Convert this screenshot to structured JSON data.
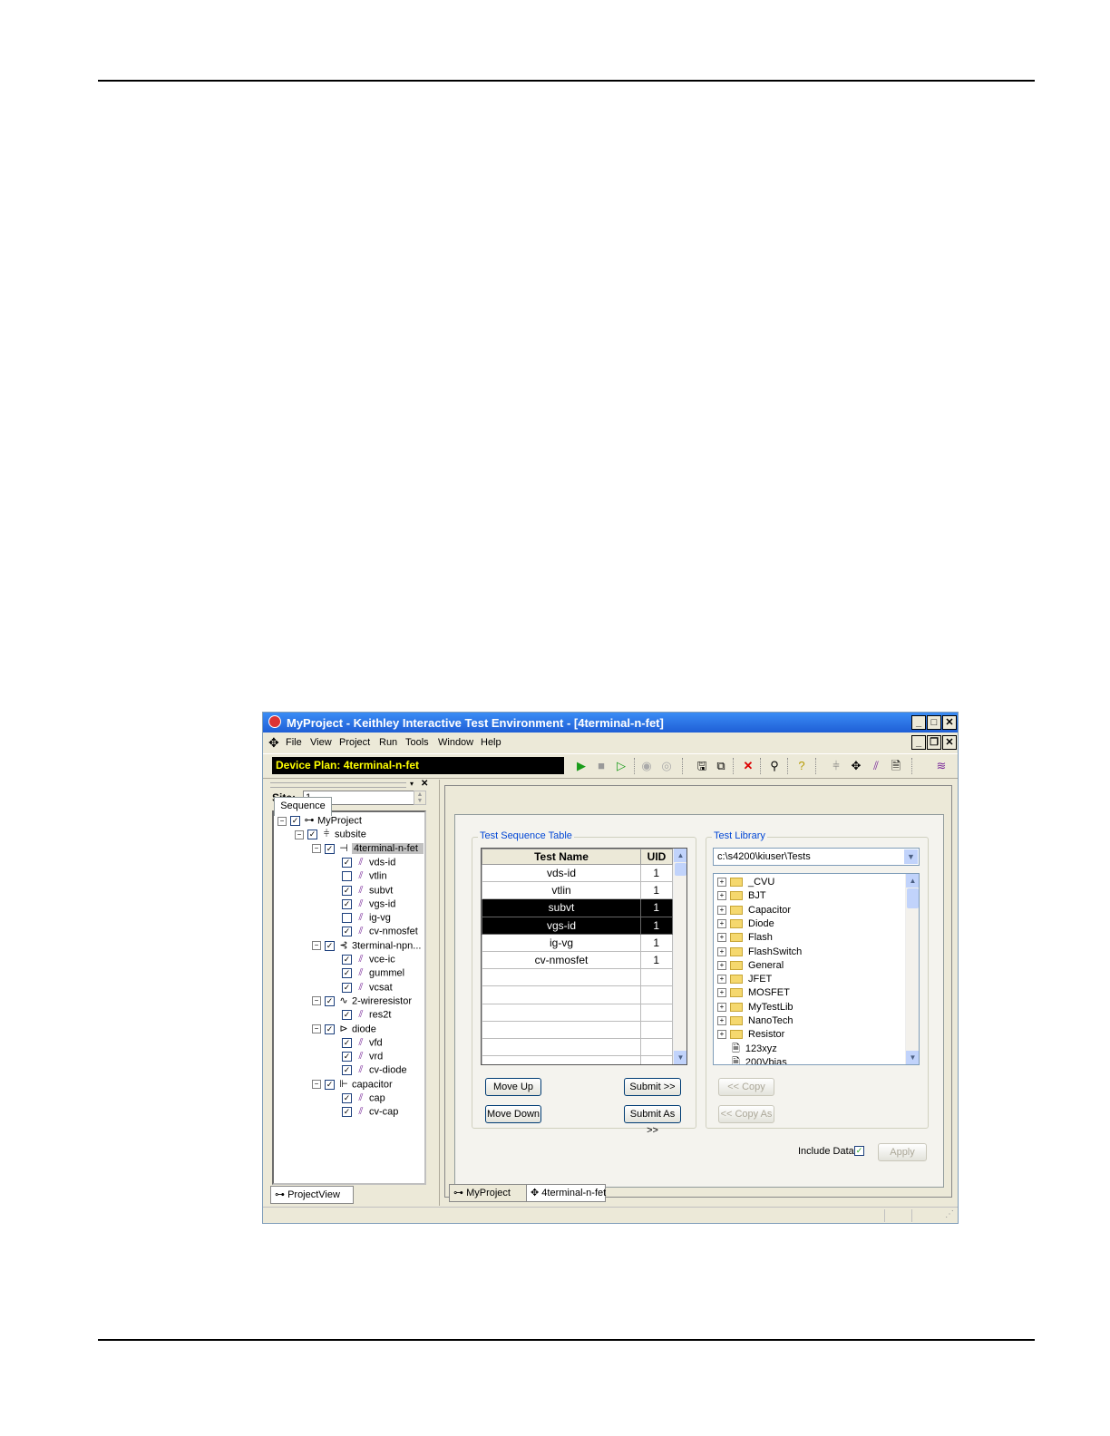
{
  "window": {
    "title": "MyProject - Keithley Interactive Test Environment - [4terminal-n-fet]",
    "min_label": "_",
    "max_label": "□",
    "close_label": "✕",
    "restore_label": "❐"
  },
  "menu": {
    "app_icon": "chip-icon",
    "items": [
      "File",
      "View",
      "Project",
      "Run",
      "Tools",
      "Window",
      "Help"
    ]
  },
  "toolbar": {
    "device_plan": "Device Plan: 4terminal-n-fet"
  },
  "site": {
    "label": "Site:",
    "value": "1"
  },
  "project_tree": [
    {
      "label": "MyProject",
      "checked": true,
      "icon": "project-icon"
    },
    {
      "label": "subsite",
      "checked": true,
      "icon": "subsite-icon"
    },
    {
      "label": "4terminal-n-fet",
      "checked": true,
      "icon": "fet-icon"
    },
    {
      "label": "vds-id",
      "checked": true,
      "icon": "test-icon"
    },
    {
      "label": "vtlin",
      "checked": false,
      "icon": "test-icon"
    },
    {
      "label": "subvt",
      "checked": true,
      "icon": "test-icon"
    },
    {
      "label": "vgs-id",
      "checked": true,
      "icon": "test-icon"
    },
    {
      "label": "ig-vg",
      "checked": false,
      "icon": "test-icon"
    },
    {
      "label": "cv-nmosfet",
      "checked": true,
      "icon": "test-icon"
    },
    {
      "label": "3terminal-npn...",
      "checked": true,
      "icon": "bjt-icon"
    },
    {
      "label": "vce-ic",
      "checked": true,
      "icon": "test-icon"
    },
    {
      "label": "gummel",
      "checked": true,
      "icon": "test-icon"
    },
    {
      "label": "vcsat",
      "checked": true,
      "icon": "test-icon"
    },
    {
      "label": "2-wireresistor",
      "checked": true,
      "icon": "resistor-icon"
    },
    {
      "label": "res2t",
      "checked": true,
      "icon": "test-icon"
    },
    {
      "label": "diode",
      "checked": true,
      "icon": "diode-icon"
    },
    {
      "label": "vfd",
      "checked": true,
      "icon": "test-icon"
    },
    {
      "label": "vrd",
      "checked": true,
      "icon": "test-icon"
    },
    {
      "label": "cv-diode",
      "checked": true,
      "icon": "test-icon"
    },
    {
      "label": "capacitor",
      "checked": true,
      "icon": "capacitor-icon"
    },
    {
      "label": "cap",
      "checked": true,
      "icon": "test-icon"
    },
    {
      "label": "cv-cap",
      "checked": true,
      "icon": "test-icon"
    }
  ],
  "left_tab": "ProjectView",
  "sequence": {
    "tab": "Sequence",
    "group_label": "Test Sequence Table",
    "col_name": "Test Name",
    "col_uid": "UID",
    "rows": [
      {
        "name": "vds-id",
        "uid": "1",
        "selected": false
      },
      {
        "name": "vtlin",
        "uid": "1",
        "selected": false
      },
      {
        "name": "subvt",
        "uid": "1",
        "selected": true
      },
      {
        "name": "vgs-id",
        "uid": "1",
        "selected": true
      },
      {
        "name": "ig-vg",
        "uid": "1",
        "selected": false
      },
      {
        "name": "cv-nmosfet",
        "uid": "1",
        "selected": false
      }
    ],
    "move_up": "Move Up",
    "move_down": "Move Down",
    "submit": "Submit >>",
    "submit_as": "Submit As >>"
  },
  "library": {
    "group_label": "Test Library",
    "path": "c:\\s4200\\kiuser\\Tests",
    "folders": [
      "_CVU",
      "BJT",
      "Capacitor",
      "Diode",
      "Flash",
      "FlashSwitch",
      "General",
      "JFET",
      "MOSFET",
      "MyTestLib",
      "NanoTech",
      "Resistor"
    ],
    "files": [
      "123xyz",
      "200Vbias"
    ],
    "copy": "<< Copy",
    "copy_as": "<< Copy As"
  },
  "include_data": "Include Data",
  "apply": "Apply",
  "bottom_tabs": [
    "MyProject",
    "4terminal-n-fet"
  ]
}
